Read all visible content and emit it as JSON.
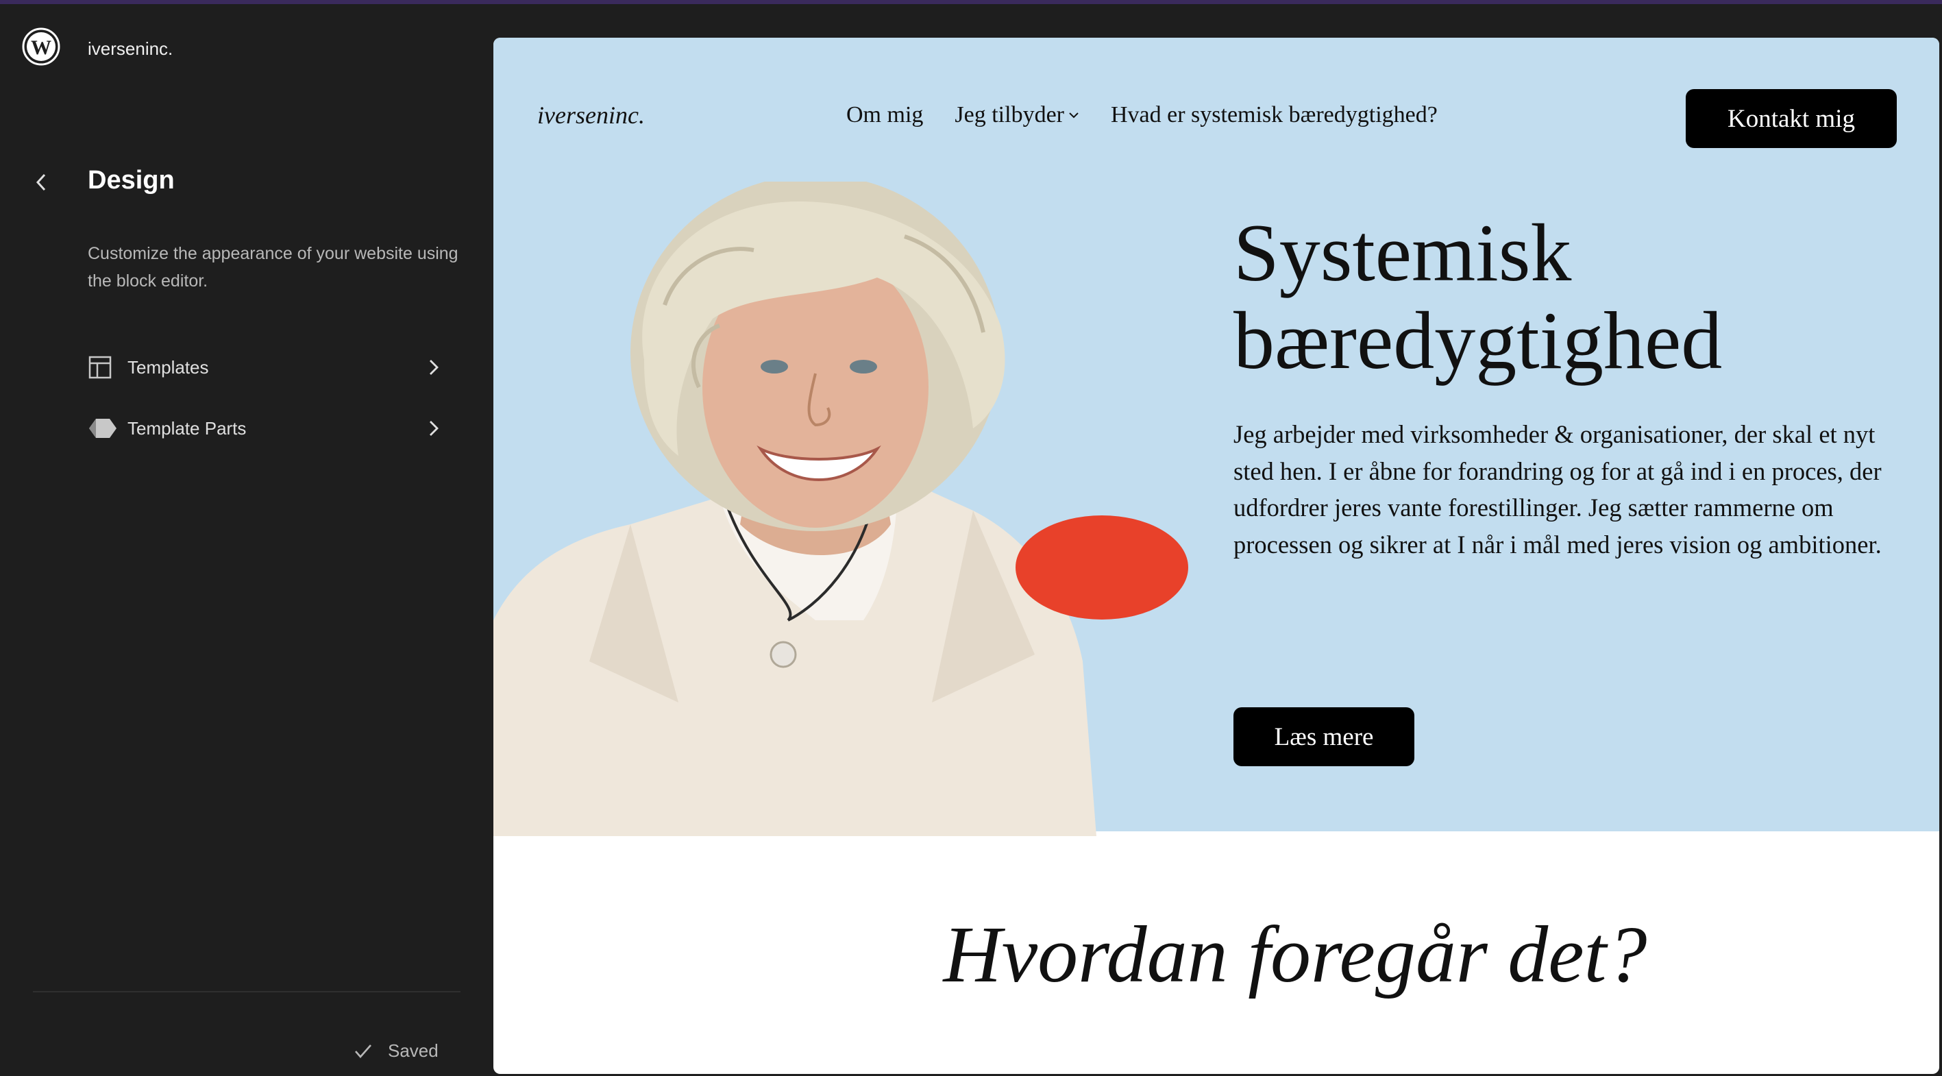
{
  "app": {
    "site_name": "iverseninc.",
    "logo_icon": "wordpress-icon"
  },
  "sidebar": {
    "title": "Design",
    "description": "Customize the appearance of your website using the block editor.",
    "items": [
      {
        "label": "Templates",
        "icon": "layout-icon"
      },
      {
        "label": "Template Parts",
        "icon": "diamond-icon"
      }
    ],
    "status": "Saved"
  },
  "site": {
    "logo": "iverseninc.",
    "nav": [
      "Om mig",
      "Jeg tilbyder",
      "Hvad er systemisk bæredygtighed?"
    ],
    "contact_label": "Kontakt mig",
    "hero_title": "Systemisk bæredygtighed",
    "hero_text": "Jeg arbejder med virksomheder & organisationer, der skal et nyt sted hen. I er åbne for forandring og for at gå ind i en proces, der udfordrer jeres vante forestillinger. Jeg sætter rammerne om processen og sikrer at I når i mål med jeres vision og ambitioner.",
    "read_more_label": "Læs mere",
    "section_title": "Hvordan foregår det?"
  },
  "colors": {
    "sidebar_bg": "#1e1e1e",
    "hero_bg": "#c2ddef",
    "accent_dot": "#e8412a",
    "button_bg": "#000000"
  }
}
